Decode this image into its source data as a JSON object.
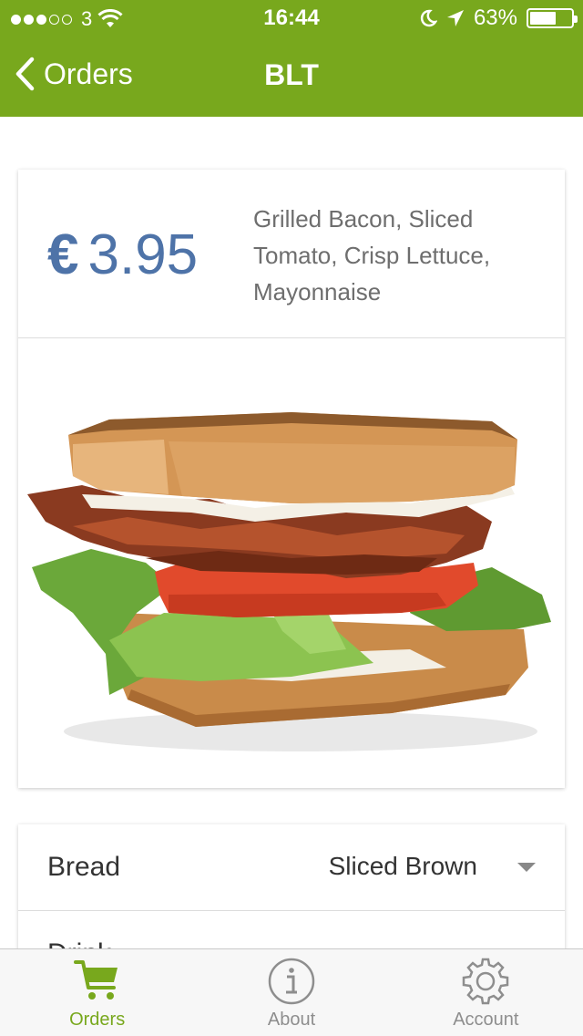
{
  "status_bar": {
    "carrier": "3",
    "time": "16:44",
    "battery": "63%",
    "battery_level": 0.63
  },
  "nav": {
    "back_label": "Orders",
    "title": "BLT"
  },
  "product": {
    "currency": "€",
    "price": "3.95",
    "description": "Grilled Bacon, Sliced Tomato, Crisp Lettuce, Mayonnaise"
  },
  "options": [
    {
      "label": "Bread",
      "value": "Sliced Brown"
    },
    {
      "label": "Drink"
    }
  ],
  "tabs": [
    {
      "label": "Orders",
      "icon": "cart-icon",
      "active": true
    },
    {
      "label": "About",
      "icon": "info-icon",
      "active": false
    },
    {
      "label": "Account",
      "icon": "gear-icon",
      "active": false
    }
  ],
  "colors": {
    "brand_green": "#78a81d",
    "price_blue": "#4e73a8",
    "tab_inactive": "#8e8e8e"
  }
}
